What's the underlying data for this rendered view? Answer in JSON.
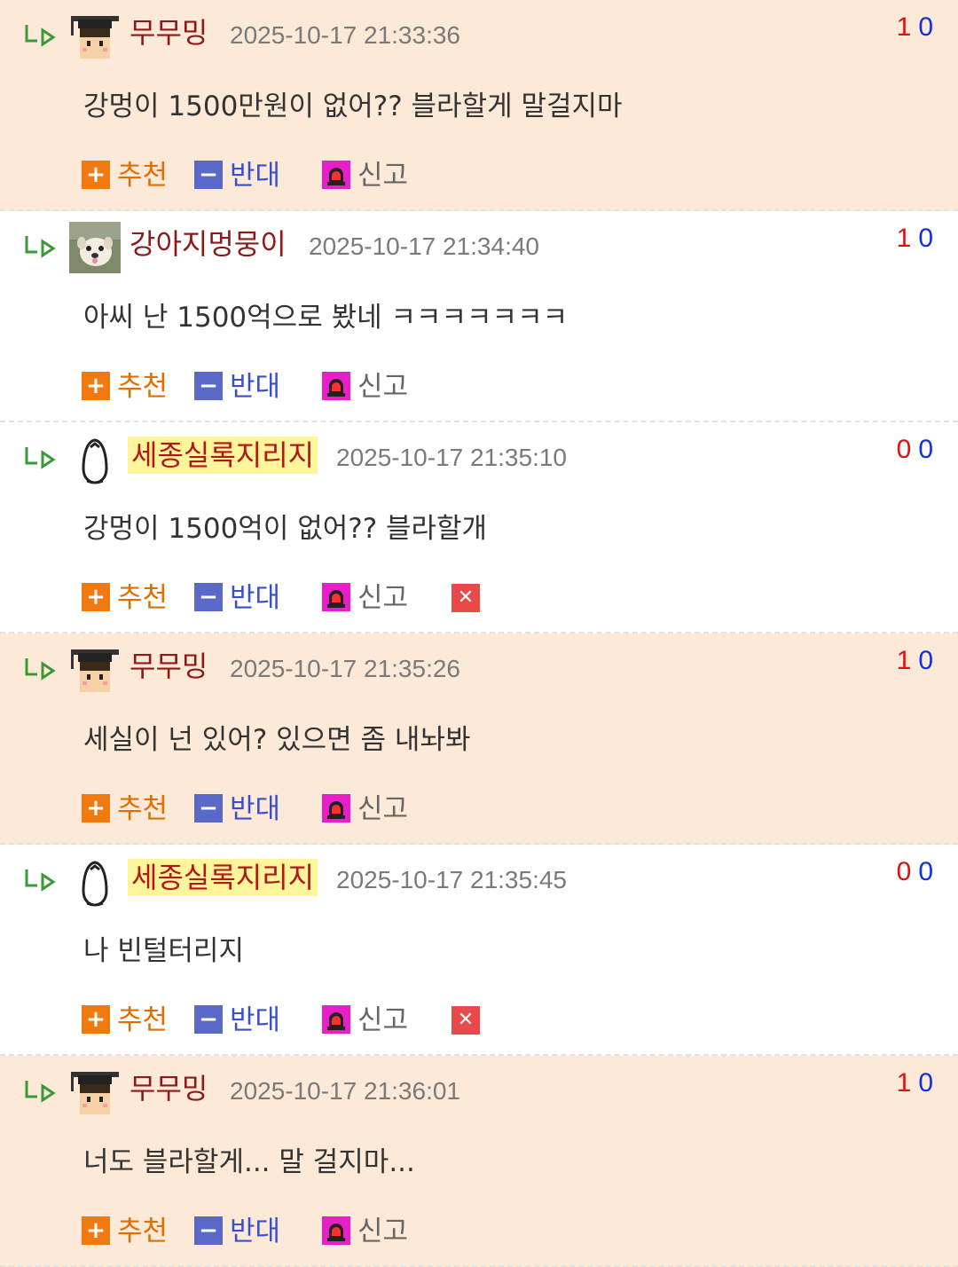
{
  "actions": {
    "recommend_label": "추천",
    "oppose_label": "반대",
    "report_label": "신고"
  },
  "icons": {
    "reply": "reply-arrow-icon",
    "recommend": "plus-square-icon",
    "oppose": "minus-square-icon",
    "report": "siren-icon",
    "delete": "close-square-icon"
  },
  "colors": {
    "highlight_bg": "#fde9d7",
    "nick": "#8b1a1a",
    "nick_badge_bg": "#fff59a",
    "up_score": "#e01010",
    "down_score": "#1030e0",
    "recommend": "#f07a10",
    "oppose": "#5a68c8",
    "report": "#e81ec8",
    "delete": "#e84a4a"
  },
  "comments": [
    {
      "nick": "무무밍",
      "avatar": "graduation-cap-avatar",
      "time": "2025-10-17 21:33:36",
      "up": "1",
      "down": "0",
      "text": "강멍이 1500만원이 없어?? 블라할게 말걸지마",
      "highlighted": true,
      "deletable": false
    },
    {
      "nick": "강아지멍뭉이",
      "avatar": "puppy-photo-avatar",
      "time": "2025-10-17 21:34:40",
      "up": "1",
      "down": "0",
      "text": "아씨 난 1500억으로 봤네 ㅋㅋㅋㅋㅋㅋㅋ",
      "highlighted": false,
      "deletable": false
    },
    {
      "nick": "세종실록지리지",
      "avatar": "penguin-avatar",
      "time": "2025-10-17 21:35:10",
      "up": "0",
      "down": "0",
      "text": "강멍이 1500억이 없어?? 블라할개",
      "highlighted": false,
      "deletable": true
    },
    {
      "nick": "무무밍",
      "avatar": "graduation-cap-avatar",
      "time": "2025-10-17 21:35:26",
      "up": "1",
      "down": "0",
      "text": "세실이 넌 있어? 있으면 좀 내놔봐",
      "highlighted": true,
      "deletable": false
    },
    {
      "nick": "세종실록지리지",
      "avatar": "penguin-avatar",
      "time": "2025-10-17 21:35:45",
      "up": "0",
      "down": "0",
      "text": "나 빈털터리지",
      "highlighted": false,
      "deletable": true
    },
    {
      "nick": "무무밍",
      "avatar": "graduation-cap-avatar",
      "time": "2025-10-17 21:36:01",
      "up": "1",
      "down": "0",
      "text": "너도 블라할게... 말 걸지마...",
      "highlighted": true,
      "deletable": false
    }
  ]
}
